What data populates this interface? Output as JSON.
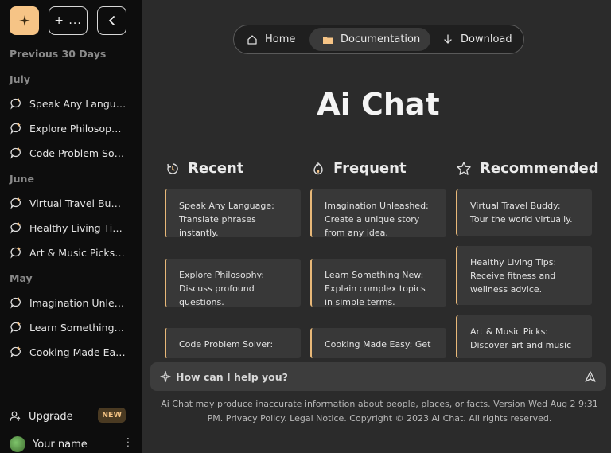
{
  "sidebar": {
    "section_title": "Previous 30 Days",
    "new_label": "+ ...",
    "groups": [
      {
        "label": "July",
        "items": [
          "Speak Any Language: Translate",
          "Explore Philosophy: Discuss",
          "Code Problem Solver"
        ]
      },
      {
        "label": "June",
        "items": [
          "Virtual Travel Buddy: Tour",
          "Healthy Living Tips: Receive",
          "Art & Music Picks: Discover"
        ]
      },
      {
        "label": "May",
        "items": [
          "Imagination Unleashed: Create",
          "Learn Something New: Explain",
          "Cooking Made Easy: Get"
        ]
      }
    ],
    "upgrade_label": "Upgrade",
    "upgrade_badge": "NEW",
    "user_name": "Your name"
  },
  "nav": {
    "home": "Home",
    "documentation": "Documentation",
    "download": "Download",
    "active": "documentation"
  },
  "title": "Ai Chat",
  "columns": [
    {
      "heading": "Recent",
      "icon": "recent-icon",
      "cards": [
        "Speak Any Language: Translate phrases instantly.",
        "Explore Philosophy: Discuss profound questions.",
        "Code Problem Solver:"
      ]
    },
    {
      "heading": "Frequent",
      "icon": "fire-icon",
      "cards": [
        "Imagination Unleashed: Create a unique story from any idea.",
        "Learn Something New: Explain complex topics in simple terms.",
        "Cooking Made Easy: Get"
      ]
    },
    {
      "heading": "Recommended",
      "icon": "star-icon",
      "cards": [
        "Virtual Travel Buddy: Tour the world virtually.",
        "Healthy Living Tips: Receive fitness and wellness advice.",
        "Art & Music Picks: Discover art and music"
      ]
    }
  ],
  "prompt": {
    "placeholder": "How can I help you?"
  },
  "disclaimer": "Ai Chat may produce inaccurate information about people, places, or facts. Version Wed Aug 2 9:31 PM. Privacy Policy. Legal Notice. Copyright © 2023 Ai Chat. All rights reserved.",
  "colors": {
    "accent": "#f6c486",
    "sidebar_bg": "#0d0d0d",
    "main_bg": "#2b2b2b",
    "card_bg": "#383838"
  }
}
